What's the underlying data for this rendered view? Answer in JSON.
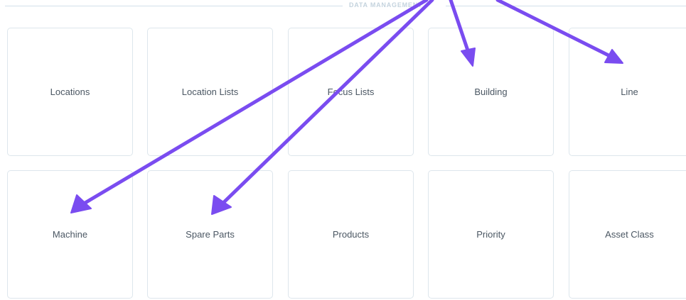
{
  "section": {
    "title": "DATA MANAGEMENT"
  },
  "tiles_row1": [
    {
      "label": "Locations"
    },
    {
      "label": "Location Lists"
    },
    {
      "label": "Focus Lists"
    },
    {
      "label": "Building"
    },
    {
      "label": "Line"
    }
  ],
  "tiles_row2": [
    {
      "label": "Machine"
    },
    {
      "label": "Spare Parts"
    },
    {
      "label": "Products"
    },
    {
      "label": "Priority"
    },
    {
      "label": "Asset Class"
    }
  ],
  "annotation": {
    "arrow_color": "#7a4cf0"
  }
}
